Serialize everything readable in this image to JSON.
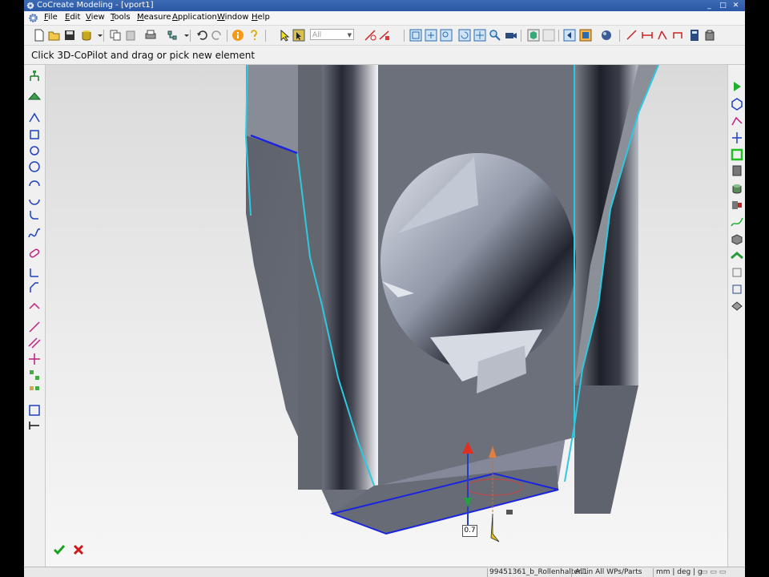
{
  "window": {
    "title": "CoCreate Modeling - [vport1]",
    "controls": {
      "minimize": "_",
      "maximize": "□",
      "close": "✕"
    }
  },
  "menu": [
    "File",
    "Edit",
    "View",
    "Tools",
    "Measure",
    "Application",
    "Window",
    "Help"
  ],
  "toolbar": {
    "filter_value": "All"
  },
  "prompt": "Click 3D-CoPilot and drag or pick new element",
  "copilot": {
    "value": "0.7"
  },
  "statusbar": {
    "part": "99451361_b_Rollenhalter.1",
    "scope": "All in All WPs/Parts",
    "units": "mm | deg | g"
  },
  "colors": {
    "model_face": "#6f7480",
    "edge_highlight": "#2ec8e0",
    "selected_edge": "#1a24e0",
    "background": "#e6e6e6"
  }
}
